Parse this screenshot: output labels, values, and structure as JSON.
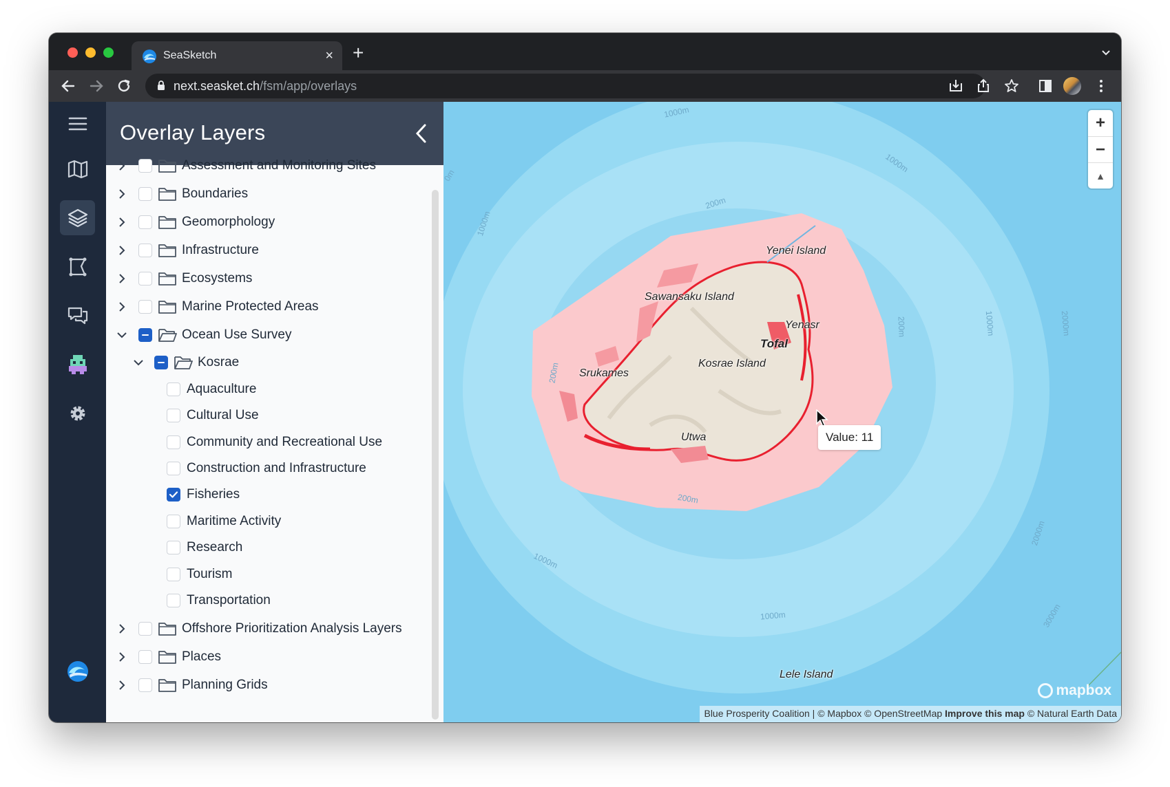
{
  "browser": {
    "tab_title": "SeaSketch",
    "tab_close": "×",
    "new_tab": "+",
    "url_host": "next.seasket.ch",
    "url_path": "/fsm/app/overlays"
  },
  "panel": {
    "title": "Overlay Layers",
    "top_items": [
      {
        "label": "Assessment and Monitoring Sites"
      },
      {
        "label": "Boundaries"
      },
      {
        "label": "Geomorphology"
      },
      {
        "label": "Infrastructure"
      },
      {
        "label": "Ecosystems"
      },
      {
        "label": "Marine Protected Areas"
      },
      {
        "label": "Ocean Use Survey"
      }
    ],
    "subfolder": {
      "label": "Kosrae"
    },
    "leaf_items": [
      {
        "label": "Aquaculture",
        "checked": false
      },
      {
        "label": "Cultural Use",
        "checked": false
      },
      {
        "label": "Community and Recreational Use",
        "checked": false
      },
      {
        "label": "Construction and Infrastructure",
        "checked": false
      },
      {
        "label": "Fisheries",
        "checked": true
      },
      {
        "label": "Maritime Activity",
        "checked": false
      },
      {
        "label": "Research",
        "checked": false
      },
      {
        "label": "Tourism",
        "checked": false
      },
      {
        "label": "Transportation",
        "checked": false
      }
    ],
    "bottom_items": [
      {
        "label": "Offshore Prioritization Analysis Layers"
      },
      {
        "label": "Places"
      },
      {
        "label": "Planning Grids"
      }
    ]
  },
  "map": {
    "tooltip": "Value: 11",
    "places": {
      "yenei": "Yenei Island",
      "sawansaku": "Sawansaku Island",
      "yenasr": "Yenasr",
      "tofal": "Tofal",
      "kosrae": "Kosrae Island",
      "srukames": "Srukames",
      "utwa": "Utwa",
      "lele": "Lele Island"
    },
    "contours": {
      "c1": "1000m",
      "c2": "1000m",
      "c3": "200m",
      "c4": "1000m",
      "c5": "200m",
      "c6": "1000m",
      "c7": "2000m",
      "c8": "200m",
      "c9": "200m",
      "c10": "1000m",
      "c11": "1000m",
      "c12": "2000m",
      "c13": "3000m",
      "c14": "0m"
    },
    "zoom_in": "+",
    "zoom_out": "−",
    "compass": "▲",
    "mapbox_brand": "mapbox",
    "attribution": {
      "blue": "Blue Prosperity Coalition",
      "sep": " | © Mapbox © OpenStreetMap ",
      "improve": "Improve this map",
      "ne": " © Natural Earth Data"
    }
  },
  "colors": {
    "rail": "#1e293b",
    "panel_header": "#3b4658",
    "checkbox_on": "#1d5fc7",
    "ocean": "#7fcdef",
    "fisheries_fill": "#fbc9cc",
    "fisheries_hot": "#e8202f"
  }
}
